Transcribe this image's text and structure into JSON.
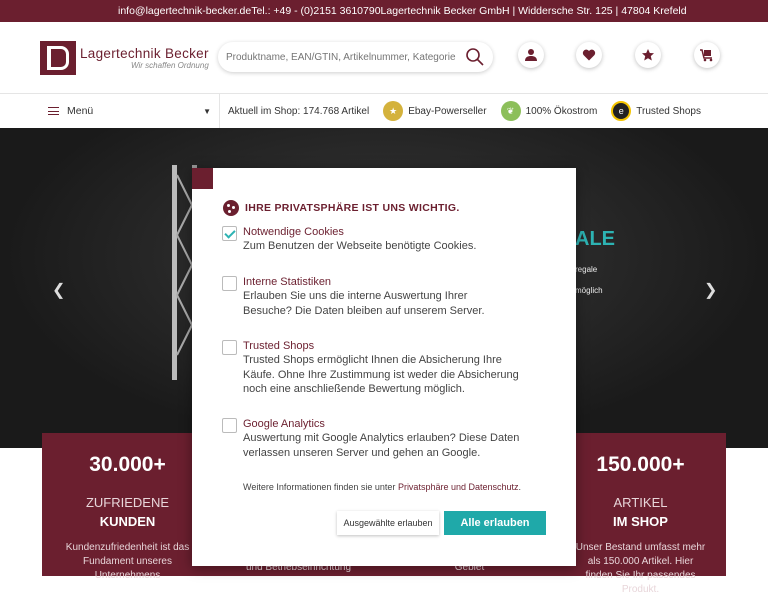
{
  "topbar": {
    "email": "info@lagertechnik-becker.de",
    "phone": "Tel.: +49 - (0)2151 3610790",
    "address": "Lagertechnik Becker GmbH | Widdersche Str. 125 | 47804 Krefeld"
  },
  "header": {
    "logo_title": "Lagertechnik Becker",
    "logo_sub": "Wir schaffen Ordnung",
    "search_placeholder": "Produktname, EAN/GTIN, Artikelnummer, Kategorie",
    "icons": [
      "user-icon",
      "heart-icon",
      "star-icon",
      "cart-icon"
    ]
  },
  "nav": {
    "menu_label": "Menü",
    "shop_count": "Aktuell im Shop: 174.768 Artikel",
    "ebay": "Ebay-Powerseller",
    "eco": "100% Ökostrom",
    "trusted": "Trusted Shops"
  },
  "hero": {
    "title_fragment": "ALE",
    "line1": "regale",
    "line2": "möglich"
  },
  "stats": [
    {
      "num": "30.000+",
      "l1": "ZUFRIEDENE",
      "l2": "KUNDEN",
      "desc": "Kundenzufriedenheit ist das Fundament unseres Unternehmens"
    },
    {
      "num": "",
      "l1": "",
      "l2": "",
      "desc": "und Betriebseinrichtung"
    },
    {
      "num": "",
      "l1": "",
      "l2": "",
      "desc": "Gebiet"
    },
    {
      "num": "150.000+",
      "l1": "ARTIKEL",
      "l2": "IM SHOP",
      "desc": "Unser Bestand umfasst mehr als 150.000 Artikel. Hier finden Sie Ihr passendes Produkt."
    }
  ],
  "modal": {
    "title": "IHRE PRIVATSPHÄRE IST UNS WICHTIG.",
    "options": [
      {
        "title": "Notwendige Cookies",
        "desc": "Zum Benutzen der Webseite benötigte Cookies.",
        "checked": true
      },
      {
        "title": "Interne Statistiken",
        "desc": "Erlauben Sie uns die interne Auswertung Ihrer Besuche? Die Daten bleiben auf unserem Server.",
        "checked": false
      },
      {
        "title": "Trusted Shops",
        "desc": "Trusted Shops ermöglicht Ihnen die Absicherung Ihre Käufe. Ohne Ihre Zustimmung ist weder die Absicherung noch eine anschließende Bewertung möglich.",
        "checked": false
      },
      {
        "title": "Google Analytics",
        "desc": "Auswertung mit Google Analytics erlauben? Diese Daten verlassen unseren Server und gehen an Google.",
        "checked": false
      }
    ],
    "info_prefix": "Weitere Informationen finden sie unter",
    "info_link": "Privatsphäre und Datenschutz",
    "info_suffix": ".",
    "btn_selected": "Ausgewählte erlauben",
    "btn_all": "Alle erlauben"
  },
  "colors": {
    "brand": "#6b1f2f",
    "accent": "#1fa9a9"
  }
}
